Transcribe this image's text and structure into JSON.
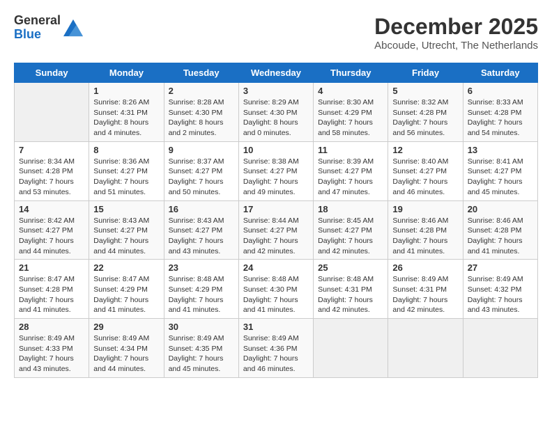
{
  "logo": {
    "general": "General",
    "blue": "Blue"
  },
  "title": "December 2025",
  "subtitle": "Abcoude, Utrecht, The Netherlands",
  "days_of_week": [
    "Sunday",
    "Monday",
    "Tuesday",
    "Wednesday",
    "Thursday",
    "Friday",
    "Saturday"
  ],
  "weeks": [
    [
      {
        "day": "",
        "sunrise": "",
        "sunset": "",
        "daylight": "",
        "empty": true
      },
      {
        "day": "1",
        "sunrise": "Sunrise: 8:26 AM",
        "sunset": "Sunset: 4:31 PM",
        "daylight": "Daylight: 8 hours and 4 minutes.",
        "empty": false
      },
      {
        "day": "2",
        "sunrise": "Sunrise: 8:28 AM",
        "sunset": "Sunset: 4:30 PM",
        "daylight": "Daylight: 8 hours and 2 minutes.",
        "empty": false
      },
      {
        "day": "3",
        "sunrise": "Sunrise: 8:29 AM",
        "sunset": "Sunset: 4:30 PM",
        "daylight": "Daylight: 8 hours and 0 minutes.",
        "empty": false
      },
      {
        "day": "4",
        "sunrise": "Sunrise: 8:30 AM",
        "sunset": "Sunset: 4:29 PM",
        "daylight": "Daylight: 7 hours and 58 minutes.",
        "empty": false
      },
      {
        "day": "5",
        "sunrise": "Sunrise: 8:32 AM",
        "sunset": "Sunset: 4:28 PM",
        "daylight": "Daylight: 7 hours and 56 minutes.",
        "empty": false
      },
      {
        "day": "6",
        "sunrise": "Sunrise: 8:33 AM",
        "sunset": "Sunset: 4:28 PM",
        "daylight": "Daylight: 7 hours and 54 minutes.",
        "empty": false
      }
    ],
    [
      {
        "day": "7",
        "sunrise": "Sunrise: 8:34 AM",
        "sunset": "Sunset: 4:28 PM",
        "daylight": "Daylight: 7 hours and 53 minutes.",
        "empty": false
      },
      {
        "day": "8",
        "sunrise": "Sunrise: 8:36 AM",
        "sunset": "Sunset: 4:27 PM",
        "daylight": "Daylight: 7 hours and 51 minutes.",
        "empty": false
      },
      {
        "day": "9",
        "sunrise": "Sunrise: 8:37 AM",
        "sunset": "Sunset: 4:27 PM",
        "daylight": "Daylight: 7 hours and 50 minutes.",
        "empty": false
      },
      {
        "day": "10",
        "sunrise": "Sunrise: 8:38 AM",
        "sunset": "Sunset: 4:27 PM",
        "daylight": "Daylight: 7 hours and 49 minutes.",
        "empty": false
      },
      {
        "day": "11",
        "sunrise": "Sunrise: 8:39 AM",
        "sunset": "Sunset: 4:27 PM",
        "daylight": "Daylight: 7 hours and 47 minutes.",
        "empty": false
      },
      {
        "day": "12",
        "sunrise": "Sunrise: 8:40 AM",
        "sunset": "Sunset: 4:27 PM",
        "daylight": "Daylight: 7 hours and 46 minutes.",
        "empty": false
      },
      {
        "day": "13",
        "sunrise": "Sunrise: 8:41 AM",
        "sunset": "Sunset: 4:27 PM",
        "daylight": "Daylight: 7 hours and 45 minutes.",
        "empty": false
      }
    ],
    [
      {
        "day": "14",
        "sunrise": "Sunrise: 8:42 AM",
        "sunset": "Sunset: 4:27 PM",
        "daylight": "Daylight: 7 hours and 44 minutes.",
        "empty": false
      },
      {
        "day": "15",
        "sunrise": "Sunrise: 8:43 AM",
        "sunset": "Sunset: 4:27 PM",
        "daylight": "Daylight: 7 hours and 44 minutes.",
        "empty": false
      },
      {
        "day": "16",
        "sunrise": "Sunrise: 8:43 AM",
        "sunset": "Sunset: 4:27 PM",
        "daylight": "Daylight: 7 hours and 43 minutes.",
        "empty": false
      },
      {
        "day": "17",
        "sunrise": "Sunrise: 8:44 AM",
        "sunset": "Sunset: 4:27 PM",
        "daylight": "Daylight: 7 hours and 42 minutes.",
        "empty": false
      },
      {
        "day": "18",
        "sunrise": "Sunrise: 8:45 AM",
        "sunset": "Sunset: 4:27 PM",
        "daylight": "Daylight: 7 hours and 42 minutes.",
        "empty": false
      },
      {
        "day": "19",
        "sunrise": "Sunrise: 8:46 AM",
        "sunset": "Sunset: 4:28 PM",
        "daylight": "Daylight: 7 hours and 41 minutes.",
        "empty": false
      },
      {
        "day": "20",
        "sunrise": "Sunrise: 8:46 AM",
        "sunset": "Sunset: 4:28 PM",
        "daylight": "Daylight: 7 hours and 41 minutes.",
        "empty": false
      }
    ],
    [
      {
        "day": "21",
        "sunrise": "Sunrise: 8:47 AM",
        "sunset": "Sunset: 4:28 PM",
        "daylight": "Daylight: 7 hours and 41 minutes.",
        "empty": false
      },
      {
        "day": "22",
        "sunrise": "Sunrise: 8:47 AM",
        "sunset": "Sunset: 4:29 PM",
        "daylight": "Daylight: 7 hours and 41 minutes.",
        "empty": false
      },
      {
        "day": "23",
        "sunrise": "Sunrise: 8:48 AM",
        "sunset": "Sunset: 4:29 PM",
        "daylight": "Daylight: 7 hours and 41 minutes.",
        "empty": false
      },
      {
        "day": "24",
        "sunrise": "Sunrise: 8:48 AM",
        "sunset": "Sunset: 4:30 PM",
        "daylight": "Daylight: 7 hours and 41 minutes.",
        "empty": false
      },
      {
        "day": "25",
        "sunrise": "Sunrise: 8:48 AM",
        "sunset": "Sunset: 4:31 PM",
        "daylight": "Daylight: 7 hours and 42 minutes.",
        "empty": false
      },
      {
        "day": "26",
        "sunrise": "Sunrise: 8:49 AM",
        "sunset": "Sunset: 4:31 PM",
        "daylight": "Daylight: 7 hours and 42 minutes.",
        "empty": false
      },
      {
        "day": "27",
        "sunrise": "Sunrise: 8:49 AM",
        "sunset": "Sunset: 4:32 PM",
        "daylight": "Daylight: 7 hours and 43 minutes.",
        "empty": false
      }
    ],
    [
      {
        "day": "28",
        "sunrise": "Sunrise: 8:49 AM",
        "sunset": "Sunset: 4:33 PM",
        "daylight": "Daylight: 7 hours and 43 minutes.",
        "empty": false
      },
      {
        "day": "29",
        "sunrise": "Sunrise: 8:49 AM",
        "sunset": "Sunset: 4:34 PM",
        "daylight": "Daylight: 7 hours and 44 minutes.",
        "empty": false
      },
      {
        "day": "30",
        "sunrise": "Sunrise: 8:49 AM",
        "sunset": "Sunset: 4:35 PM",
        "daylight": "Daylight: 7 hours and 45 minutes.",
        "empty": false
      },
      {
        "day": "31",
        "sunrise": "Sunrise: 8:49 AM",
        "sunset": "Sunset: 4:36 PM",
        "daylight": "Daylight: 7 hours and 46 minutes.",
        "empty": false
      },
      {
        "day": "",
        "sunrise": "",
        "sunset": "",
        "daylight": "",
        "empty": true
      },
      {
        "day": "",
        "sunrise": "",
        "sunset": "",
        "daylight": "",
        "empty": true
      },
      {
        "day": "",
        "sunrise": "",
        "sunset": "",
        "daylight": "",
        "empty": true
      }
    ]
  ]
}
